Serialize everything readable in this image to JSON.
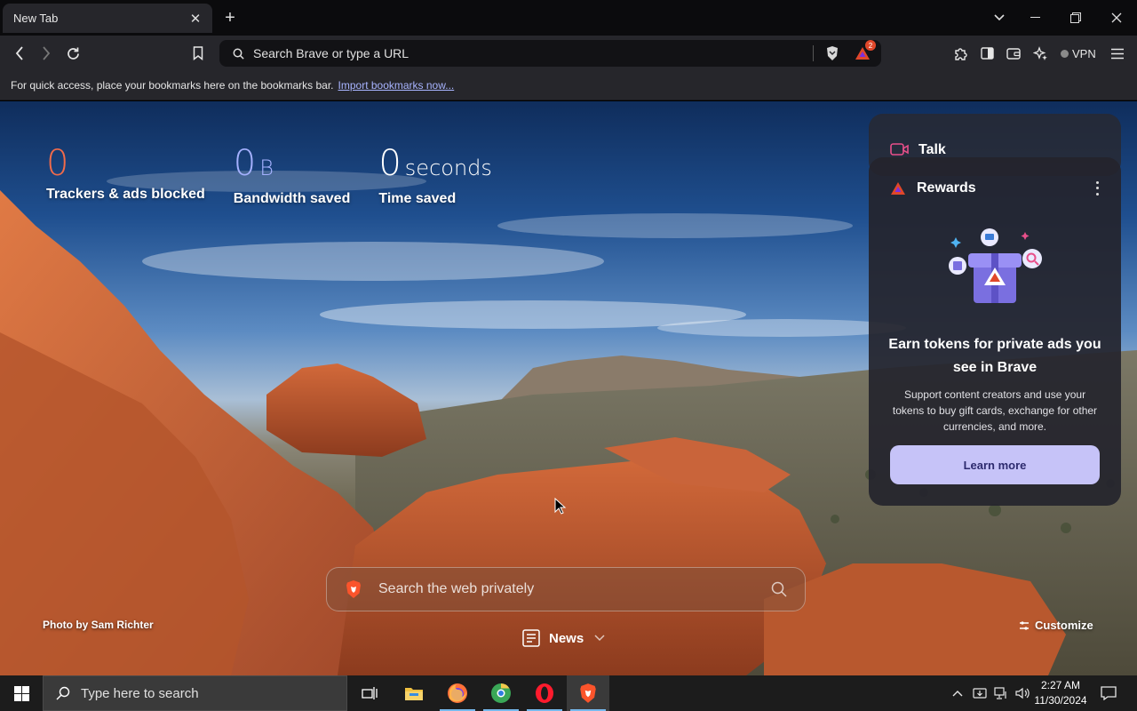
{
  "tab": {
    "title": "New Tab"
  },
  "toolbar": {
    "omnibox_placeholder": "Search Brave or type a URL",
    "rewards_badge": "2",
    "vpn_label": "VPN"
  },
  "bookmarks_bar": {
    "message": "For quick access, place your bookmarks here on the bookmarks bar.",
    "import_link": "Import bookmarks now..."
  },
  "stats": [
    {
      "value": "0",
      "unit": "",
      "label": "Trackers & ads blocked",
      "color": "#f26b4a"
    },
    {
      "value": "0",
      "unit": "B",
      "label": "Bandwidth saved",
      "color": "#a5b1ff"
    },
    {
      "value": "0",
      "unit": "seconds",
      "label": "Time saved",
      "color": "#ffffff"
    }
  ],
  "talk_card": {
    "title": "Talk"
  },
  "rewards_card": {
    "title": "Rewards",
    "heading": "Earn tokens for private ads you see in Brave",
    "description": "Support content creators and use your tokens to buy gift cards, exchange for other currencies, and more.",
    "button": "Learn more"
  },
  "ntp_search": {
    "placeholder": "Search the web privately"
  },
  "photo_credit": "Photo by Sam Richter",
  "news": {
    "label": "News"
  },
  "customize": {
    "label": "Customize"
  },
  "taskbar": {
    "search_placeholder": "Type here to search",
    "time": "2:27 AM",
    "date": "11/30/2024"
  },
  "colors": {
    "brave_orange": "#fb542b",
    "accent_purple": "#c6c3f8"
  }
}
